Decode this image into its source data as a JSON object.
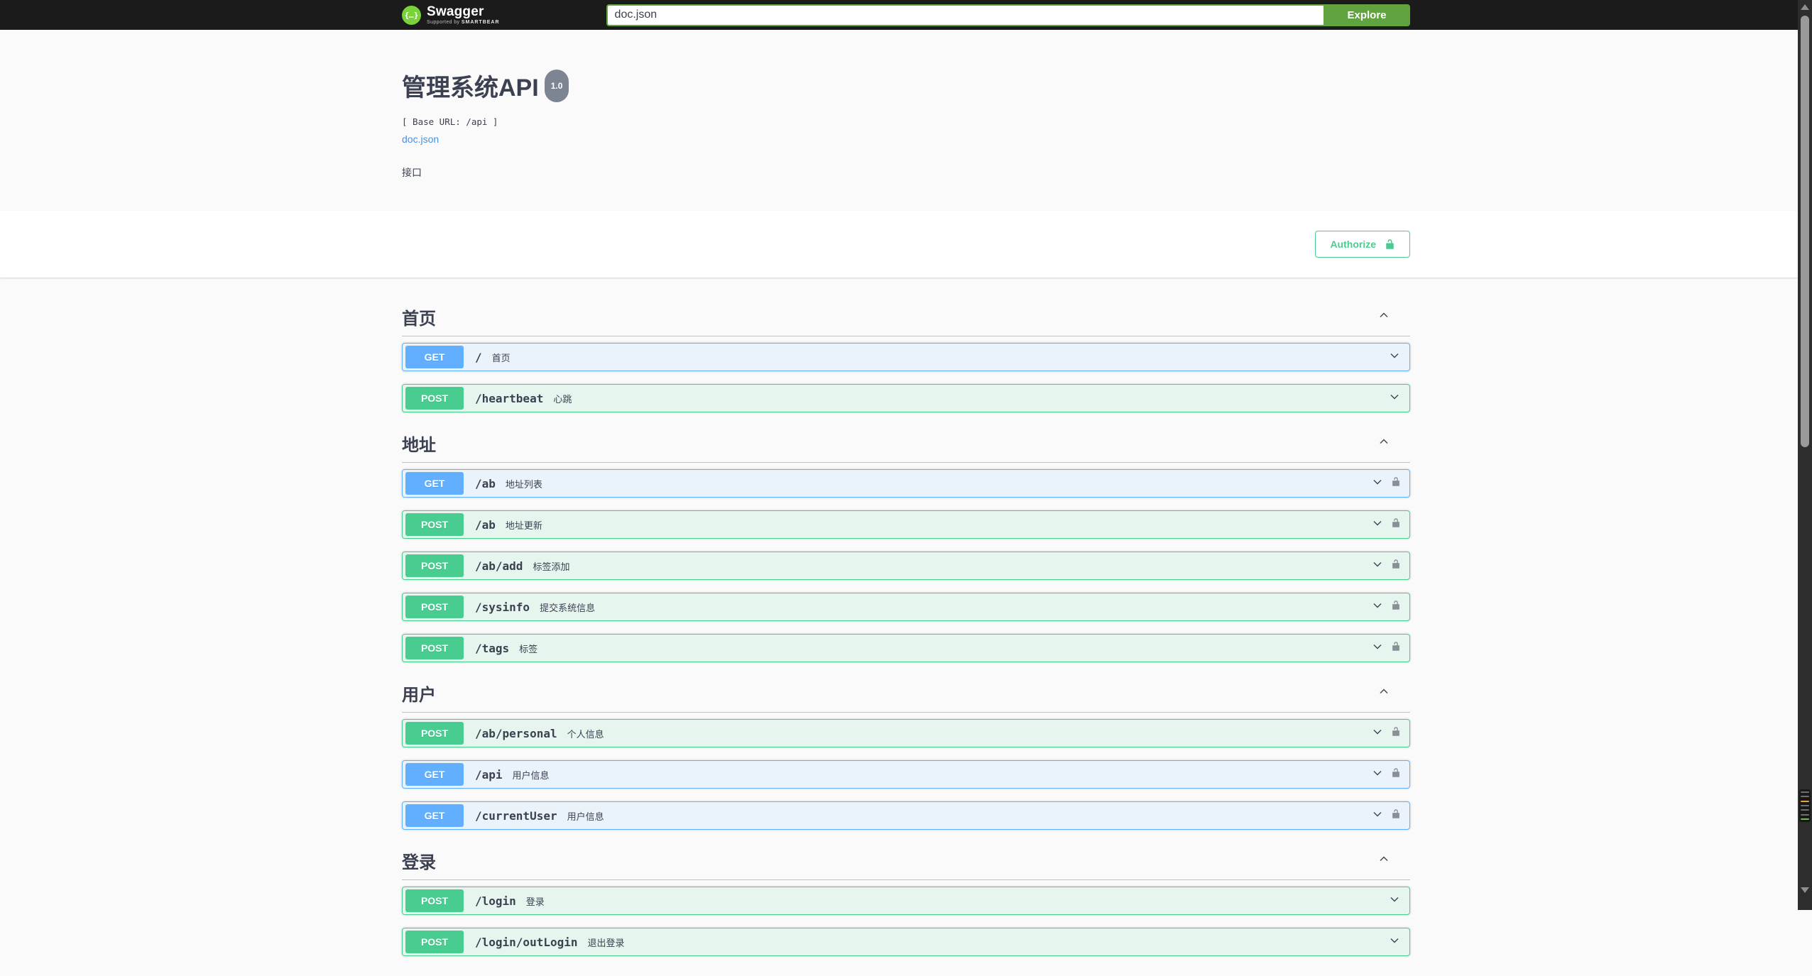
{
  "topbar": {
    "brand": "Swagger",
    "brand_sub_prefix": "Supported by",
    "brand_sub_brand": "SMARTBEAR",
    "search_value": "doc.json",
    "explore_label": "Explore"
  },
  "info": {
    "title": "管理系统API",
    "version": "1.0",
    "base_url": "[ Base URL: /api ]",
    "spec_link": "doc.json",
    "description": "接口"
  },
  "auth": {
    "authorize_label": "Authorize"
  },
  "colors": {
    "get": "#61affe",
    "post": "#49cc90",
    "topbar_bg": "#1b1b1b",
    "explore_green": "#61a43f",
    "link": "#4990e2",
    "text": "#3b4151",
    "body_bg": "#fafafa"
  },
  "sections": [
    {
      "name": "首页",
      "expanded": true,
      "operations": [
        {
          "method": "GET",
          "path": "/",
          "summary": "首页",
          "lock": false
        },
        {
          "method": "POST",
          "path": "/heartbeat",
          "summary": "心跳",
          "lock": false
        }
      ]
    },
    {
      "name": "地址",
      "expanded": true,
      "operations": [
        {
          "method": "GET",
          "path": "/ab",
          "summary": "地址列表",
          "lock": true
        },
        {
          "method": "POST",
          "path": "/ab",
          "summary": "地址更新",
          "lock": true
        },
        {
          "method": "POST",
          "path": "/ab/add",
          "summary": "标签添加",
          "lock": true
        },
        {
          "method": "POST",
          "path": "/sysinfo",
          "summary": "提交系统信息",
          "lock": true
        },
        {
          "method": "POST",
          "path": "/tags",
          "summary": "标签",
          "lock": true
        }
      ]
    },
    {
      "name": "用户",
      "expanded": true,
      "operations": [
        {
          "method": "POST",
          "path": "/ab/personal",
          "summary": "个人信息",
          "lock": true
        },
        {
          "method": "GET",
          "path": "/api",
          "summary": "用户信息",
          "lock": true
        },
        {
          "method": "GET",
          "path": "/currentUser",
          "summary": "用户信息",
          "lock": true
        }
      ]
    },
    {
      "name": "登录",
      "expanded": true,
      "operations": [
        {
          "method": "POST",
          "path": "/login",
          "summary": "登录",
          "lock": false
        },
        {
          "method": "POST",
          "path": "/login/outLogin",
          "summary": "退出登录",
          "lock": false
        }
      ]
    }
  ]
}
